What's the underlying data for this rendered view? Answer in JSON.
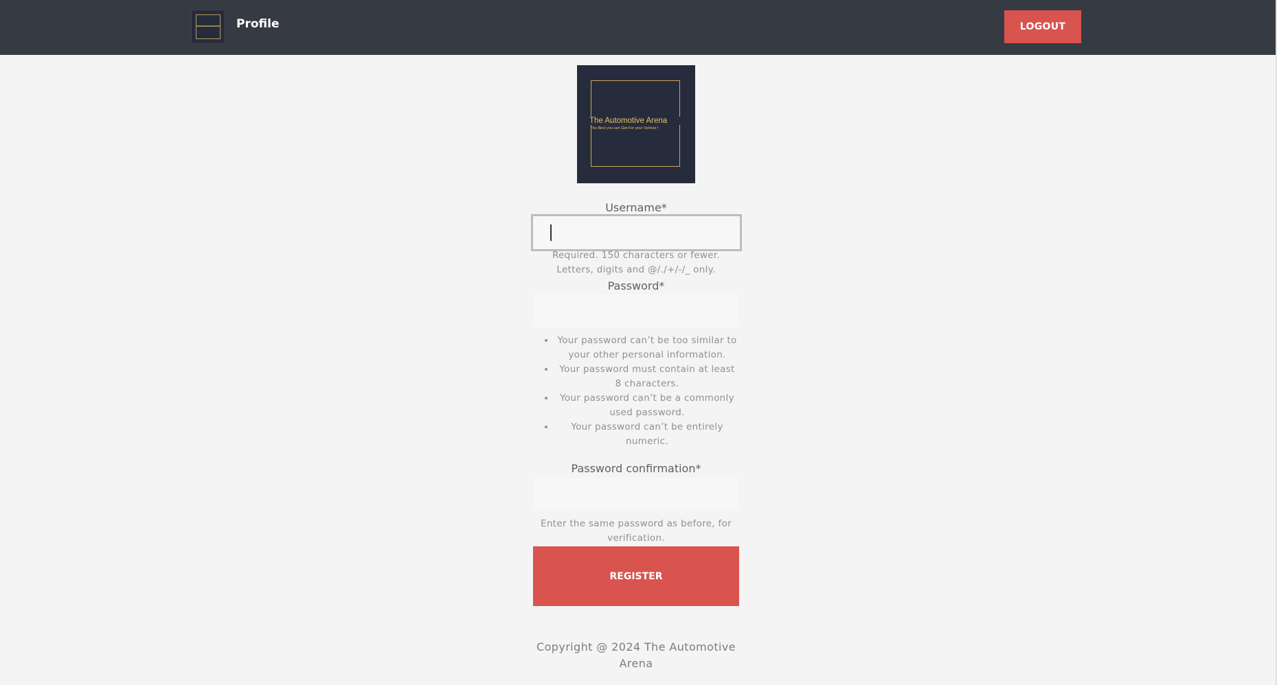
{
  "navbar": {
    "title": "Profile",
    "logout_label": "LOGOUT"
  },
  "logo": {
    "name": "The Automotive Arena",
    "tagline": "The Best you can Get For your Vehicle !"
  },
  "form": {
    "username": {
      "label": "Username*",
      "value": "",
      "help": "Required. 150 characters or fewer. Letters, digits and @/./+/-/_ only."
    },
    "password": {
      "label": "Password*",
      "value": "",
      "rules": [
        "Your password can’t be too similar to your other personal information.",
        "Your password must contain at least 8 characters.",
        "Your password can’t be a commonly used password.",
        "Your password can’t be entirely numeric."
      ]
    },
    "password_confirmation": {
      "label": "Password confirmation*",
      "value": "",
      "help": "Enter the same password as before, for verification."
    },
    "submit_label": "REGISTER"
  },
  "footer": {
    "copyright": "Copyright @ 2024 The Automotive Arena"
  },
  "colors": {
    "navbar_bg": "#363a43",
    "accent": "#d9534f",
    "page_bg": "#f4f4f4",
    "logo_bg": "#272c3d",
    "logo_gold": "#e8c060"
  }
}
